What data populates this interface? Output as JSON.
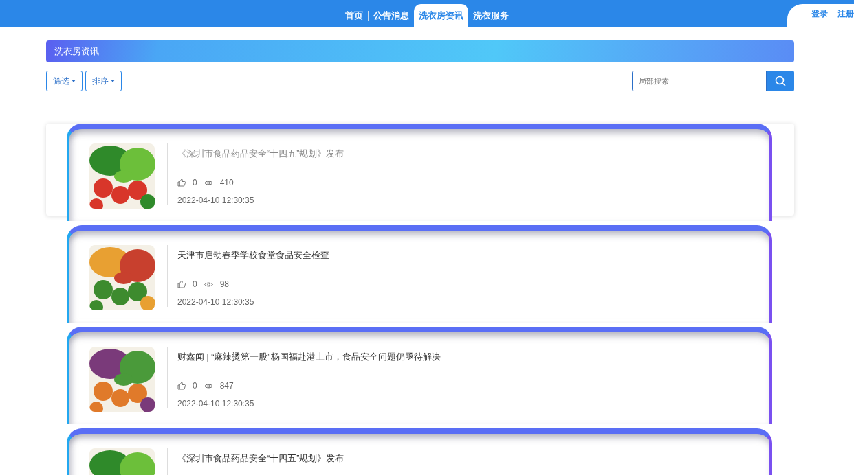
{
  "nav": {
    "items": [
      {
        "label": "首页",
        "selected": false
      },
      {
        "label": "公告消息",
        "selected": false
      },
      {
        "label": "洗衣房资讯",
        "selected": true
      },
      {
        "label": "洗衣服务",
        "selected": false
      }
    ],
    "auth": [
      "登录",
      "注册"
    ]
  },
  "banner": {
    "title": "洗衣房资讯"
  },
  "toolbar": {
    "filters": [
      "筛选",
      "排序"
    ],
    "search": {
      "placeholder": "局部搜索"
    }
  },
  "articles": [
    {
      "kind": "picture",
      "title": "《深圳市食品药品安全“十四五”规划》发布",
      "likes": "0",
      "views": "410",
      "date": "2022-04-10 12:30:35",
      "hovered": true
    },
    {
      "kind": "picture",
      "title": "天津市启动春季学校食堂食品安全检查",
      "likes": "0",
      "views": "98",
      "date": "2022-04-10 12:30:35",
      "hovered": false
    },
    {
      "kind": "picture",
      "title": "财鑫闻 | “麻辣烫第一股”杨国福赴港上市，食品安全问题仍亟待解决",
      "likes": "0",
      "views": "847",
      "date": "2022-04-10 12:30:35",
      "hovered": false
    },
    {
      "kind": "picture",
      "title": "《深圳市食品药品安全“十四五”规划》发布",
      "hovered": false
    }
  ]
}
